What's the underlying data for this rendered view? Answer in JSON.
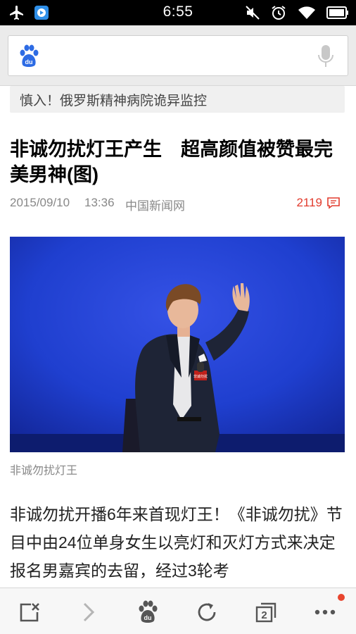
{
  "status_bar": {
    "time": "6:55",
    "icons": [
      "airplane-icon",
      "app-notification-icon",
      "mute-icon",
      "alarm-icon",
      "wifi-icon",
      "battery-icon"
    ]
  },
  "search": {
    "logo_text": "du",
    "placeholder": "",
    "value": ""
  },
  "article": {
    "previous_snippet": "慎入！俄罗斯精神病院诡异监控",
    "title": "非诚勿扰灯王产生　超高颜值被赞最完美男神(图)",
    "date": "2015/09/10",
    "time": "13:36",
    "source": "中国新闻网",
    "comment_count": "2119",
    "image_caption": "非诚勿扰灯王",
    "image_badge_text": "非诚勿扰",
    "body": "非诚勿扰开播6年来首现灯王！《非诚勿扰》节目中由24位单身女生以亮灯和灭灯方式来决定报名男嘉宾的去留，经过3轮考"
  },
  "toolbar": {
    "tabs_count": "2",
    "buttons": [
      "close-page-icon",
      "forward-icon",
      "baidu-home-icon",
      "refresh-icon",
      "tabs-icon",
      "more-icon"
    ],
    "has_notification": true
  },
  "colors": {
    "accent_red": "#e23c2e",
    "baidu_blue": "#2d6be4",
    "stage_blue": "#1f3fcf"
  }
}
